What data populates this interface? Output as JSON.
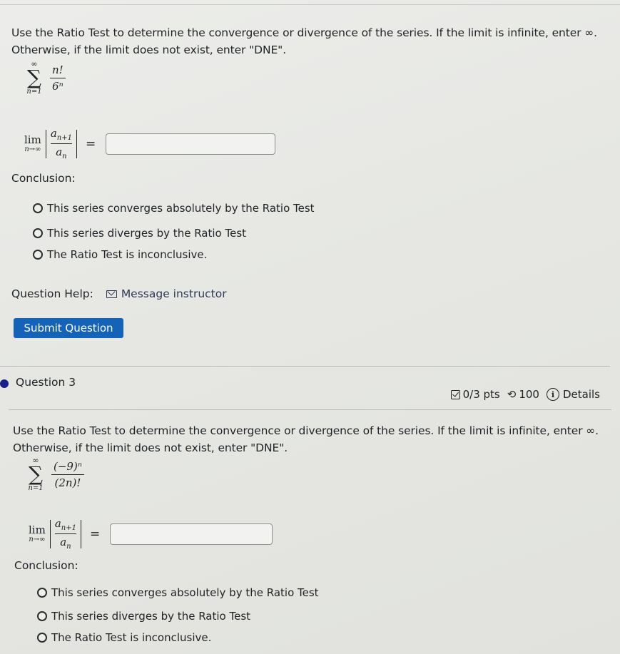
{
  "question2": {
    "instructions": "Use the Ratio Test to determine the convergence or divergence of the series. If the limit is infinite, enter ∞. Otherwise, if the limit does not exist, enter \"DNE\".",
    "series": {
      "sigma_top": "∞",
      "sigma_bottom": "n=1",
      "numerator": "n!",
      "denominator": "6ⁿ"
    },
    "limit": {
      "lim": "lim",
      "sub": "n→∞",
      "numerator": "a",
      "numerator_sub": "n+1",
      "denominator": "a",
      "denominator_sub": "n",
      "equals": "=",
      "answer_value": ""
    },
    "conclusion_label": "Conclusion:",
    "options": [
      "This series converges absolutely by the Ratio Test",
      "This series diverges by the Ratio Test",
      "The Ratio Test is inconclusive."
    ],
    "help_label": "Question Help:",
    "message_instructor": "Message instructor",
    "submit_label": "Submit Question"
  },
  "question3": {
    "title": "Question 3",
    "points": "0/3 pts",
    "attempts": "100",
    "details": "Details",
    "bullet_color": "#1a1f8a",
    "instructions": "Use the Ratio Test to determine the convergence or divergence of the series. If the limit is infinite, enter ∞. Otherwise, if the limit does not exist, enter \"DNE\".",
    "series": {
      "sigma_top": "∞",
      "sigma_bottom": "n=1",
      "numerator": "(−9)ⁿ",
      "denominator": "(2n)!"
    },
    "limit": {
      "lim": "lim",
      "sub": "n→∞",
      "numerator": "a",
      "numerator_sub": "n+1",
      "denominator": "a",
      "denominator_sub": "n",
      "equals": "=",
      "answer_value": ""
    },
    "conclusion_label": "Conclusion:",
    "options": [
      "This series converges absolutely by the Ratio Test",
      "This series diverges by the Ratio Test",
      "The Ratio Test is inconclusive."
    ]
  },
  "colors": {
    "submit_button": "#1463b8",
    "link": "#2e3a55"
  }
}
